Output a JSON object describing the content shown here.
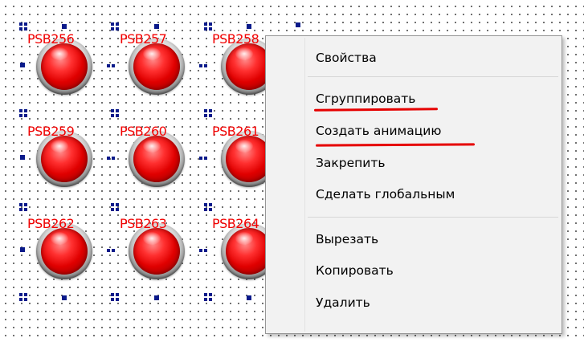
{
  "buttons": [
    {
      "label": "PSB256"
    },
    {
      "label": "PSB257"
    },
    {
      "label": "PSB258"
    },
    {
      "label": "PSB259"
    },
    {
      "label": "PSB260"
    },
    {
      "label": "PSB261"
    },
    {
      "label": "PSB262"
    },
    {
      "label": "PSB263"
    },
    {
      "label": "PSB264"
    }
  ],
  "context_menu": {
    "items": [
      "Свойства",
      "Сгруппировать",
      "Создать анимацию",
      "Закрепить",
      "Сделать глобальным",
      "Вырезать",
      "Копировать",
      "Удалить"
    ]
  },
  "colors": {
    "lamp": "#e00000",
    "label": "#f20000",
    "selection_handle": "#0a1a8a",
    "underline": "#e60000",
    "menu_bg": "#f2f2f2"
  },
  "icons": [
    "lamp-icon"
  ]
}
